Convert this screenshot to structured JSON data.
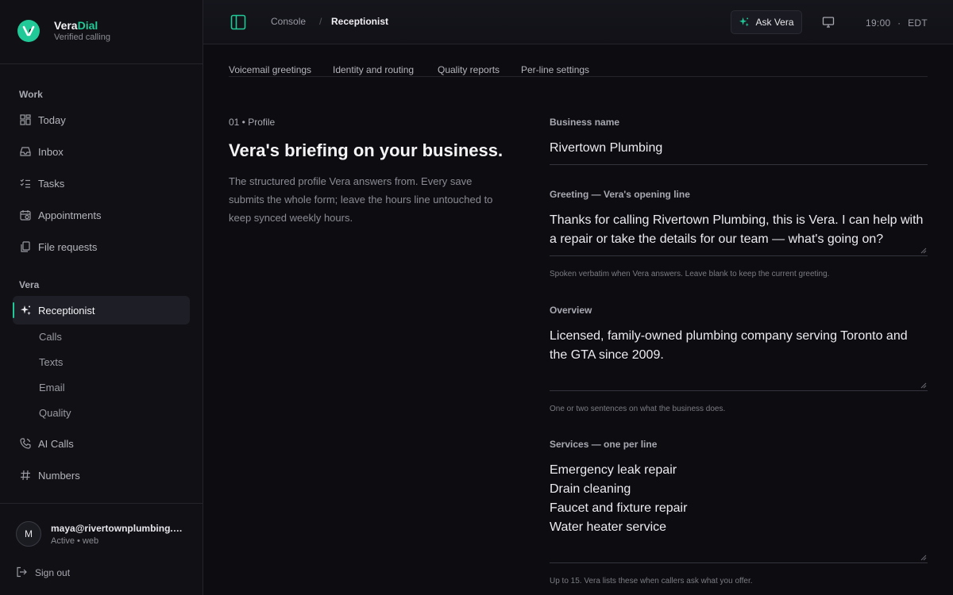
{
  "brand": {
    "name_main": "Vera",
    "name_accent": "Dial",
    "subtitle": "Verified calling"
  },
  "sidebar": {
    "sections": {
      "work": "Work",
      "vera": "Vera"
    },
    "work_items": [
      {
        "label": "Today",
        "icon": "dashboard-icon"
      },
      {
        "label": "Inbox",
        "icon": "inbox-icon"
      },
      {
        "label": "Tasks",
        "icon": "tasks-icon"
      },
      {
        "label": "Appointments",
        "icon": "calendar-icon"
      },
      {
        "label": "File requests",
        "icon": "files-icon"
      }
    ],
    "vera_items": {
      "receptionist": "Receptionist",
      "sub": [
        "Calls",
        "Texts",
        "Email",
        "Quality"
      ],
      "ai_calls": "AI Calls",
      "numbers": "Numbers"
    }
  },
  "user": {
    "initial": "M",
    "email": "maya@rivertownplumbing.com",
    "status": "Active • web",
    "signout": "Sign out"
  },
  "topbar": {
    "breadcrumb": [
      "Console",
      "Receptionist"
    ],
    "breadcrumb_sep": "/",
    "ask_label": "Ask Vera",
    "time": "19:00",
    "tz": "EDT",
    "time_sep": "·"
  },
  "tabs": [
    "Voicemail greetings",
    "Identity and routing",
    "Quality reports",
    "Per-line settings"
  ],
  "profile": {
    "kicker": "01 • Profile",
    "title": "Vera's briefing on your business.",
    "description": "The structured profile Vera answers from. Every save submits the whole form; leave the hours line untouched to keep synced weekly hours."
  },
  "form": {
    "business_name": {
      "label": "Business name",
      "value": "Rivertown Plumbing"
    },
    "greeting": {
      "label": "Greeting — Vera's opening line",
      "value": "Thanks for calling Rivertown Plumbing, this is Vera. I can help with a repair or take the details for our team — what's going on?",
      "hint": "Spoken verbatim when Vera answers. Leave blank to keep the current greeting."
    },
    "overview": {
      "label": "Overview",
      "value": "Licensed, family-owned plumbing company serving Toronto and the GTA since 2009.",
      "hint": "One or two sentences on what the business does."
    },
    "services": {
      "label": "Services — one per line",
      "value": "Emergency leak repair\nDrain cleaning\nFaucet and fixture repair\nWater heater service",
      "hint": "Up to 15. Vera lists these when callers ask what you offer."
    }
  },
  "colors": {
    "accent": "#20c997",
    "background": "#0d0d11",
    "sidebar": "#111115"
  }
}
